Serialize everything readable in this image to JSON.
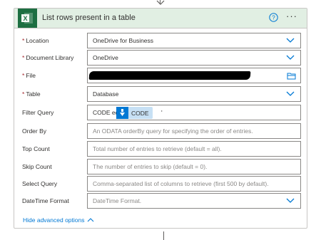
{
  "card": {
    "title": "List rows present in a table",
    "help_icon": "question-circle-icon",
    "more_icon": "more-horizontal-icon",
    "app_icon": "excel-icon",
    "accent_color": "#1d6f42",
    "header_bg": "#e1efe3"
  },
  "fields": {
    "location": {
      "label": "Location",
      "required": "*",
      "value": "OneDrive for Business"
    },
    "library": {
      "label": "Document Library",
      "required": "*",
      "value": "OneDrive"
    },
    "file": {
      "label": "File",
      "required": "*",
      "value": ""
    },
    "table": {
      "label": "Table",
      "required": "*",
      "value": "Database"
    },
    "filter": {
      "label": "Filter Query",
      "prefix": "CODE eq '",
      "token": "CODE",
      "suffix": "'"
    },
    "orderby": {
      "label": "Order By",
      "placeholder": "An ODATA orderBy query for specifying the order of entries."
    },
    "top": {
      "label": "Top Count",
      "placeholder": "Total number of entries to retrieve (default = all)."
    },
    "skip": {
      "label": "Skip Count",
      "placeholder": "The number of entries to skip (default = 0)."
    },
    "select": {
      "label": "Select Query",
      "placeholder": "Comma-separated list of columns to retrieve (first 500 by default)."
    },
    "datetime": {
      "label": "DateTime Format",
      "placeholder": "DateTime Format."
    }
  },
  "advanced": {
    "label": "Hide advanced options"
  }
}
